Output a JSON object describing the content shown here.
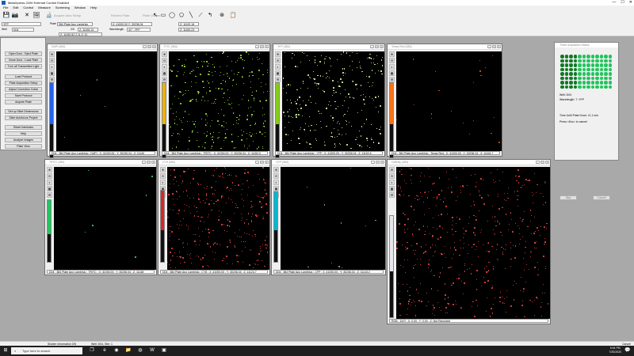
{
  "app": {
    "title": "MetaXpress 2200 External Control Enabled",
    "window_controls": [
      "—",
      "☐",
      "✕"
    ]
  },
  "menu": [
    "File",
    "Edit",
    "Control",
    "Measure",
    "Screening",
    "Window",
    "Help"
  ],
  "toolbar": {
    "dim_labels": [
      "Acquire Auto Setup",
      "Review Plate",
      "Plate Viewer"
    ],
    "run_value": "YFP",
    "plate_label": "Plate",
    "plate_value": "384 Plate Apo Lamb(sio",
    "well_label": "Well",
    "well_value": "D04",
    "coords_1": "X: 41000.00   Y: 30236.04",
    "coords_2": "Z: 11192.16",
    "counter": "2/9",
    "coords_3": "Z: 11195.13",
    "coords_4": "Z: 11150.23",
    "wavelength_label": "Wavelength",
    "wavelength_value": "4/7 : YFP",
    "coords_5": "Z: 11150.52   2.11   Z: 11"
  },
  "pad": {
    "buttons": [
      "Open Door - Eject Plate",
      "Close Door - Load Plate",
      "Turn off Transmitted Light",
      "Load Protocol",
      "Plate Acquisition Setup",
      "Adjust Correction Collar",
      "Save Protocol",
      "Acquire Plate",
      "Set up Slide Dimensions",
      "Slide Autofocus Project",
      "Reset Interlocks",
      "Help",
      "Analyze Images",
      "Plate View"
    ]
  },
  "image_windows": [
    {
      "title": "DAPI (384)",
      "status": "D04 : 384 Plate Apo Lamb(sio : DAPI : X: 41000.00 : Y: 30236.04 : Z: 11140",
      "lut": "#2563eb",
      "dots": "#4ade80",
      "count": 4
    },
    {
      "title": "FITC (384)",
      "status": "D04 : 384 Plate Apo Lamb(sio : TRITC : X: 41000.00 : Y: 30236.04 : Z: 11152.0",
      "lut": "#eab308",
      "dots": "#a3e635",
      "count": 300
    },
    {
      "title": "YFP (384)",
      "status": "D04 : 384 Plate Apo Lamb(sio : YFP : X: 41000.00 : Y: 30236.04 : Z: 11152.6",
      "lut": "#84cc16",
      "dots": "#d9f99d",
      "count": 280
    },
    {
      "title": "Texas Red (384)",
      "status": "D04 : 384 Plate Apo Lamb(sio : Texas Red : X: 41000.00 : Y: 30236.04 : Z: 11164.7",
      "lut": "#f97316",
      "dots": "#ea580c",
      "count": 20
    },
    {
      "title": "TRITC (384)",
      "status": "D04 : 384 Plate Apo Lamb(sio : TRITC : X: 41000.00 : Y: 30236.04 : Z: 11148",
      "lut": "#22c55e",
      "dots": "#4ade80",
      "count": 6
    },
    {
      "title": "CY5 (384)",
      "status": "D04 : 384 Plate Apo Lamb(sio : CY5 : X: 41000.00 : Y: 30236.04 : Z: 11124.7",
      "lut": "#dc2626",
      "dots": "#ef4444",
      "count": 320
    },
    {
      "title": "CFP (384)",
      "status": "D04 : 384 Plate Apo Lamb(sio : CFP : X: 41000.00 : Y: 30236.04 : Z: 11143.2",
      "lut": "#06b6d4",
      "dots": "#9ca3af",
      "count": 10
    },
    {
      "title": "Overlay (384)",
      "status": "RGB : 18 R : X: 0.00 : Y: 0.00 : Z: Not Recorded",
      "lut": "#e5e7eb",
      "dots": "#ef4444",
      "count": 500
    }
  ],
  "plate_window": {
    "title": "Plate Acquisition Status",
    "well_text": "Well: D04",
    "wavelength_text": "Wavelength: 7: YFP",
    "time_text": "Time Until Plate Done: 11.1 min",
    "cancel_hint": "Press <Esc> to cancel",
    "buttons": [
      "Skip",
      "Cancel"
    ],
    "wells_done_rows": 8,
    "wells_done_cols": 4
  },
  "app_status": {
    "left": "Shutter Information ON",
    "mid": "Well: D04, Site: 1",
    "right": "Cancel"
  },
  "taskbar": {
    "search_placeholder": "Type here to search",
    "time": "5:44 PM",
    "date": "7/20/2020"
  }
}
